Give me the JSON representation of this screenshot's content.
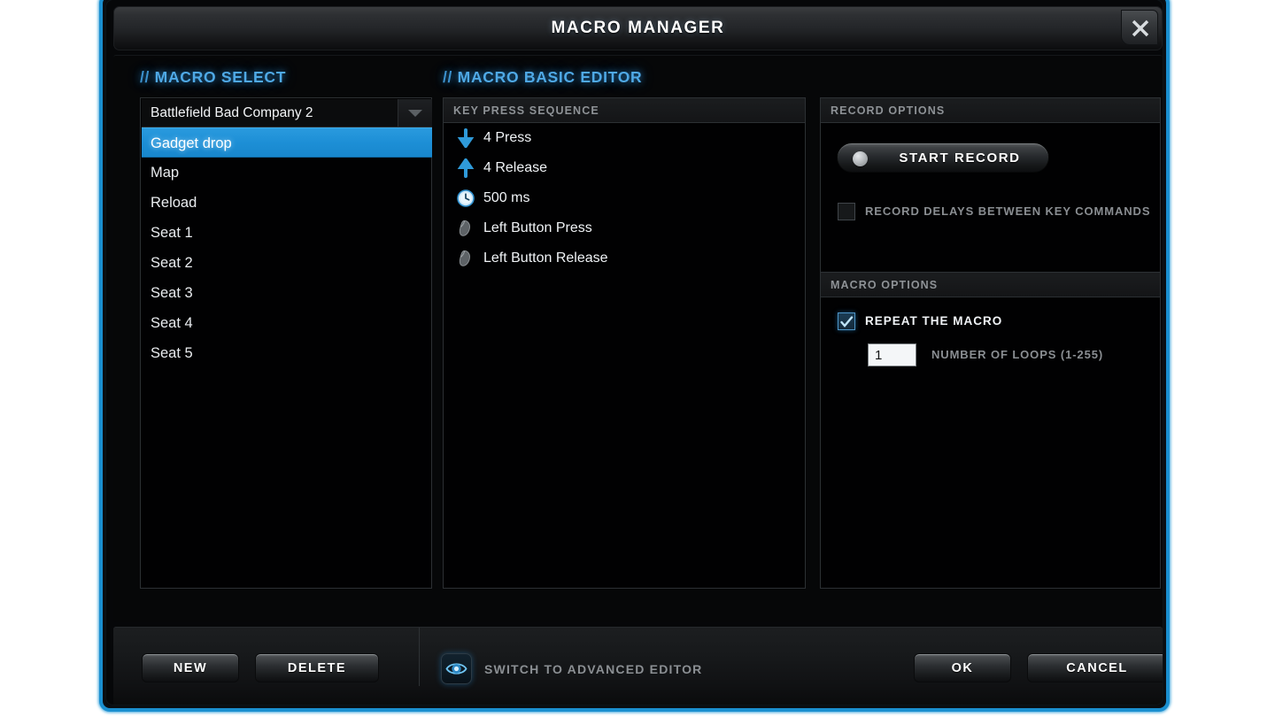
{
  "window": {
    "title": "MACRO MANAGER",
    "close_icon": "close-icon",
    "accent_color": "#1a8fd0",
    "highlight_color": "#1d8fd6"
  },
  "macro_select": {
    "section_title": "// MACRO SELECT",
    "combo": {
      "value": "Battlefield Bad Company 2",
      "arrow_icon": "chevron-down-icon"
    },
    "items": [
      {
        "label": "Gadget drop",
        "selected": true
      },
      {
        "label": "Map",
        "selected": false
      },
      {
        "label": "Reload",
        "selected": false
      },
      {
        "label": "Seat 1",
        "selected": false
      },
      {
        "label": "Seat 2",
        "selected": false
      },
      {
        "label": "Seat 3",
        "selected": false
      },
      {
        "label": "Seat 4",
        "selected": false
      },
      {
        "label": "Seat 5",
        "selected": false
      }
    ]
  },
  "basic_editor": {
    "section_title": "// MACRO BASIC EDITOR",
    "key_press_sequence": {
      "header": "KEY PRESS SEQUENCE",
      "items": [
        {
          "label": "4 Press",
          "icon": "arrow-down-icon"
        },
        {
          "label": "4 Release",
          "icon": "arrow-up-icon"
        },
        {
          "label": "500 ms",
          "icon": "clock-icon"
        },
        {
          "label": "Left Button Press",
          "icon": "mouse-icon"
        },
        {
          "label": "Left Button Release",
          "icon": "mouse-icon"
        }
      ]
    },
    "record_options": {
      "header": "RECORD OPTIONS",
      "start_record_label": "START RECORD",
      "record_dot_icon": "record-dot-icon",
      "record_delays_label": "RECORD DELAYS BETWEEN KEY COMMANDS",
      "record_delays_checked": false
    },
    "macro_options": {
      "header": "MACRO OPTIONS",
      "repeat_label": "REPEAT THE MACRO",
      "repeat_checked": true,
      "loops_value": "1",
      "loops_placeholder": "1",
      "loops_label": "NUMBER OF LOOPS (1-255)"
    }
  },
  "footer": {
    "new_label": "NEW",
    "delete_label": "DELETE",
    "advanced_label": "SWITCH TO ADVANCED EDITOR",
    "advanced_icon": "eye-icon",
    "ok_label": "OK",
    "cancel_label": "CANCEL"
  }
}
